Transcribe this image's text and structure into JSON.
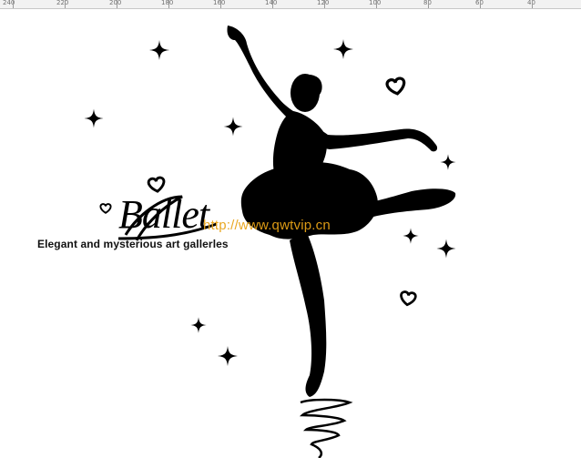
{
  "ruler": {
    "ticks": [
      "240",
      "220",
      "200",
      "180",
      "160",
      "140",
      "120",
      "100",
      "80",
      "60",
      "40"
    ]
  },
  "artwork": {
    "logo_text": "Ballet",
    "tagline": "Elegant and mysterious art gallerles",
    "watermark": "http://www.qwtvip.cn"
  },
  "colors": {
    "silhouette": "#000000",
    "watermark": "#e8a317",
    "background": "#ffffff",
    "ruler_bg": "#f2f2f2"
  },
  "icons": [
    "sparkle-star-icon",
    "heart-icon"
  ]
}
